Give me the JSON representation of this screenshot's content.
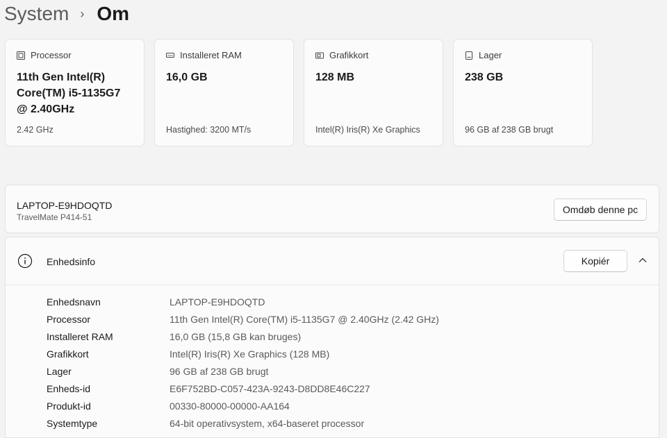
{
  "breadcrumb": {
    "parent": "System",
    "separator": "›",
    "current": "Om"
  },
  "cards": [
    {
      "icon": "processor-icon",
      "label": "Processor",
      "value": "11th Gen Intel(R) Core(TM) i5-1135G7 @ 2.40GHz",
      "sub": "2.42 GHz"
    },
    {
      "icon": "ram-icon",
      "label": "Installeret RAM",
      "value": "16,0 GB",
      "sub": "Hastighed: 3200 MT/s"
    },
    {
      "icon": "graphics-card-icon",
      "label": "Grafikkort",
      "value": "128 MB",
      "sub": "Intel(R) Iris(R) Xe Graphics"
    },
    {
      "icon": "storage-icon",
      "label": "Lager",
      "value": "238 GB",
      "sub": "96 GB af 238 GB brugt"
    }
  ],
  "device": {
    "name": "LAPTOP-E9HDOQTD",
    "model": "TravelMate P414-51",
    "rename_label": "Omdøb denne pc"
  },
  "info": {
    "title": "Enhedsinfo",
    "copy_label": "Kopiér",
    "rows": [
      {
        "label": "Enhedsnavn",
        "value": "LAPTOP-E9HDOQTD"
      },
      {
        "label": "Processor",
        "value": "11th Gen Intel(R) Core(TM) i5-1135G7 @ 2.40GHz (2.42 GHz)"
      },
      {
        "label": "Installeret RAM",
        "value": "16,0 GB (15,8 GB kan bruges)"
      },
      {
        "label": "Grafikkort",
        "value": "Intel(R) Iris(R) Xe Graphics (128 MB)"
      },
      {
        "label": "Lager",
        "value": "96 GB af 238 GB brugt"
      },
      {
        "label": "Enheds-id",
        "value": "E6F752BD-C057-423A-9243-D8DD8E46C227"
      },
      {
        "label": "Produkt-id",
        "value": "00330-80000-00000-AA164"
      },
      {
        "label": "Systemtype",
        "value": "64-bit operativsystem, x64-baseret processor"
      }
    ]
  }
}
